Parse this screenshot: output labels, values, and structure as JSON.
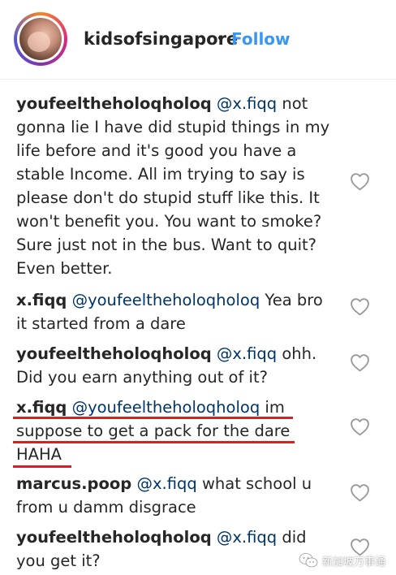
{
  "header": {
    "username": "kidsofsingapore",
    "separator": "•",
    "follow_label": "Follow"
  },
  "comments": [
    {
      "author": "youfeeltheholoqholoq",
      "mention": "@x.fiqq",
      "text": " not gonna lie I have did stupid things in my life before and it's good you have a stable Income. All im trying to say is please don't do stupid stuff like this. It won't benefit you. You want to smoke? Sure just not in the bus. Want to quit? Even better."
    },
    {
      "author": "x.fiqq",
      "mention": "@youfeeltheholoqholoq",
      "text": " Yea bro it started from a dare"
    },
    {
      "author": "youfeeltheholoqholoq",
      "mention": "@x.fiqq",
      "text": " ohh. Did you earn anything out of it?"
    },
    {
      "author": "x.fiqq",
      "mention": "@youfeeltheholoqholoq",
      "text": " im suppose to get a pack for the dare HAHA"
    },
    {
      "author": "marcus.poop",
      "mention": "@x.fiqq",
      "text": " what school u from u damm disgrace"
    },
    {
      "author": "youfeeltheholoqholoq",
      "mention": "@x.fiqq",
      "text": " did you get it?"
    }
  ],
  "icons": {
    "like": "heart-outline-icon",
    "watermark": "wechat-icon"
  },
  "colors": {
    "accent": "#3897f0",
    "mention": "#003569",
    "highlight_underline": "#d81f26"
  },
  "watermark": {
    "text": "新加坡万事通"
  }
}
